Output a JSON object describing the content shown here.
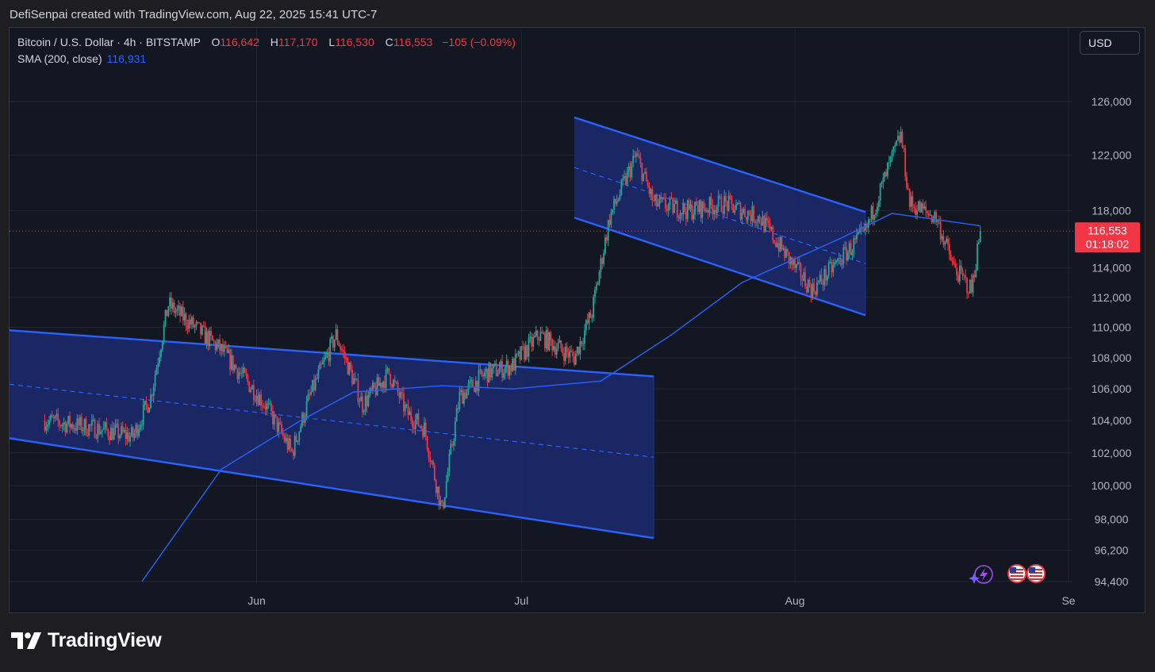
{
  "header": {
    "credit": "DefiSenpai created with TradingView.com, Aug 22, 2025 15:41 UTC-7"
  },
  "legend": {
    "symbol": "Bitcoin / U.S. Dollar · 4h · BITSTAMP",
    "o_label": "O",
    "o_value": "116,642",
    "h_label": "H",
    "h_value": "117,170",
    "l_label": "L",
    "l_value": "116,530",
    "c_label": "C",
    "c_value": "116,553",
    "change": "−105 (−0.09%)",
    "sma_label": "SMA (200, close)",
    "sma_value": "116,931"
  },
  "currency_button": "USD",
  "price_badge": {
    "price": "116,553",
    "countdown": "01:18:02"
  },
  "brand": {
    "name": "TradingView"
  },
  "colors": {
    "up": "#26a69a",
    "down": "#f23645",
    "sma": "#2962ff",
    "channel_line": "#2962ff",
    "channel_fill": "#1c2a6e",
    "background": "#131722",
    "text": "#b2b5be"
  },
  "icons": [
    "lightning-event-icon",
    "us-flag-event-icon",
    "us-flag-event-icon"
  ],
  "chart_data": {
    "type": "candlestick",
    "title": "Bitcoin / U.S. Dollar · 4h · BITSTAMP",
    "y_scale": "log",
    "ylim": [
      94400,
      126000
    ],
    "y_ticks": [
      "126,000",
      "122,000",
      "118,000",
      "114,000",
      "112,000",
      "110,000",
      "108,000",
      "106,000",
      "104,000",
      "102,000",
      "100,000",
      "98,000",
      "96,200",
      "94,400"
    ],
    "x_ticks": [
      "Jun",
      "Jul",
      "Aug",
      "Se"
    ],
    "last_price": 116553,
    "series": [
      {
        "name": "Bitcoin / U.S. Dollar",
        "approx_close_path": [
          [
            "2025-05-08",
            104000
          ],
          [
            "2025-05-14",
            103500
          ],
          [
            "2025-05-18",
            103000
          ],
          [
            "2025-05-20",
            105500
          ],
          [
            "2025-05-22",
            111500
          ],
          [
            "2025-05-26",
            109500
          ],
          [
            "2025-05-28",
            108500
          ],
          [
            "2025-06-02",
            105000
          ],
          [
            "2025-06-05",
            102000
          ],
          [
            "2025-06-07",
            105500
          ],
          [
            "2025-06-10",
            109500
          ],
          [
            "2025-06-13",
            105000
          ],
          [
            "2025-06-16",
            107000
          ],
          [
            "2025-06-18",
            104500
          ],
          [
            "2025-06-20",
            103500
          ],
          [
            "2025-06-22",
            98500
          ],
          [
            "2025-06-24",
            105500
          ],
          [
            "2025-06-27",
            107000
          ],
          [
            "2025-06-30",
            107500
          ],
          [
            "2025-07-03",
            109500
          ],
          [
            "2025-07-07",
            108000
          ],
          [
            "2025-07-09",
            111000
          ],
          [
            "2025-07-11",
            117500
          ],
          [
            "2025-07-14",
            122000
          ],
          [
            "2025-07-16",
            118500
          ],
          [
            "2025-07-20",
            118000
          ],
          [
            "2025-07-24",
            118500
          ],
          [
            "2025-07-28",
            117500
          ],
          [
            "2025-08-01",
            114000
          ],
          [
            "2025-08-03",
            112500
          ],
          [
            "2025-08-06",
            114500
          ],
          [
            "2025-08-09",
            116500
          ],
          [
            "2025-08-11",
            120000
          ],
          [
            "2025-08-13",
            123500
          ],
          [
            "2025-08-14",
            118500
          ],
          [
            "2025-08-17",
            117500
          ],
          [
            "2025-08-19",
            114000
          ],
          [
            "2025-08-21",
            112500
          ],
          [
            "2025-08-22",
            116553
          ]
        ]
      },
      {
        "name": "SMA (200, close)",
        "approx_path": [
          [
            "2025-05-19",
            94400
          ],
          [
            "2025-05-28",
            101000
          ],
          [
            "2025-06-06",
            104000
          ],
          [
            "2025-06-12",
            105800
          ],
          [
            "2025-06-22",
            106200
          ],
          [
            "2025-06-30",
            106000
          ],
          [
            "2025-07-10",
            106500
          ],
          [
            "2025-07-18",
            109500
          ],
          [
            "2025-07-26",
            113000
          ],
          [
            "2025-08-06",
            116000
          ],
          [
            "2025-08-12",
            117800
          ],
          [
            "2025-08-22",
            116931
          ]
        ]
      }
    ],
    "annotations": [
      {
        "type": "parallel_channel",
        "from": "2025-05-04",
        "to": "2025-07-16",
        "upper": [
          109800,
          106800
        ],
        "lower": [
          102900,
          96900
        ]
      },
      {
        "type": "parallel_channel",
        "from": "2025-07-07",
        "to": "2025-08-09",
        "upper": [
          124800,
          117900
        ],
        "lower": [
          117500,
          110800
        ]
      }
    ]
  }
}
